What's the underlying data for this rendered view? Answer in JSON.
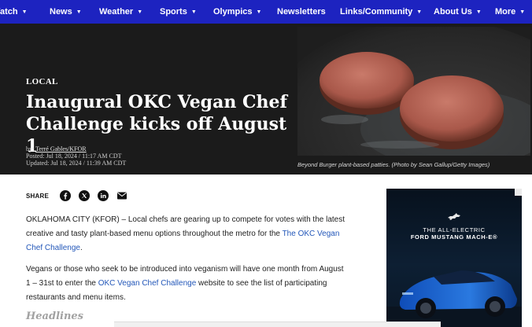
{
  "nav": {
    "items": [
      {
        "label": "Watch",
        "has_caret": true
      },
      {
        "label": "News",
        "has_caret": true
      },
      {
        "label": "Weather",
        "has_caret": true
      },
      {
        "label": "Sports",
        "has_caret": true
      },
      {
        "label": "Olympics",
        "has_caret": true
      },
      {
        "label": "Newsletters",
        "has_caret": false
      },
      {
        "label": "Links/Community",
        "has_caret": true
      },
      {
        "label": "About Us",
        "has_caret": true
      },
      {
        "label": "More",
        "has_caret": true
      }
    ],
    "caret_glyph": "▼",
    "background": "#1d23c0"
  },
  "article": {
    "kicker": "LOCAL",
    "headline": "Inaugural OKC Vegan Chef Challenge kicks off August 1",
    "byline_prefix": "by: ",
    "author": "Terré Gables/KFOR",
    "posted": "Posted: Jul 18, 2024 / 11:17 AM CDT",
    "updated": "Updated: Jul 18, 2024 / 11:39 AM CDT",
    "image_caption": "Beyond Burger plant-based patties. (Photo by Sean Gallup/Getty Images)",
    "share_label": "SHARE",
    "share_icons": [
      "facebook-icon",
      "x-icon",
      "linkedin-icon",
      "email-icon"
    ],
    "p1_text": "OKLAHOMA CITY (KFOR) – Local chefs are gearing up to compete for votes with the latest creative and tasty plant-based menu options throughout the metro for the ",
    "p1_link": "The OKC Vegan Chef Challenge",
    "p1_end": ".",
    "p2_text_a": "Vegans or those who seek to be introduced into veganism will have one month from August 1 – 31st to enter the ",
    "p2_link": "OKC Vegan Chef Challenge",
    "p2_text_b": " website to see the list of participating restaurants and menu items.",
    "headlines_label": "Headlines",
    "link_color": "#2357b9"
  },
  "ad": {
    "line1": "THE ALL-ELECTRIC",
    "line2": "FORD MUSTANG MACH-E®",
    "logo": "mustang-pony-icon"
  }
}
